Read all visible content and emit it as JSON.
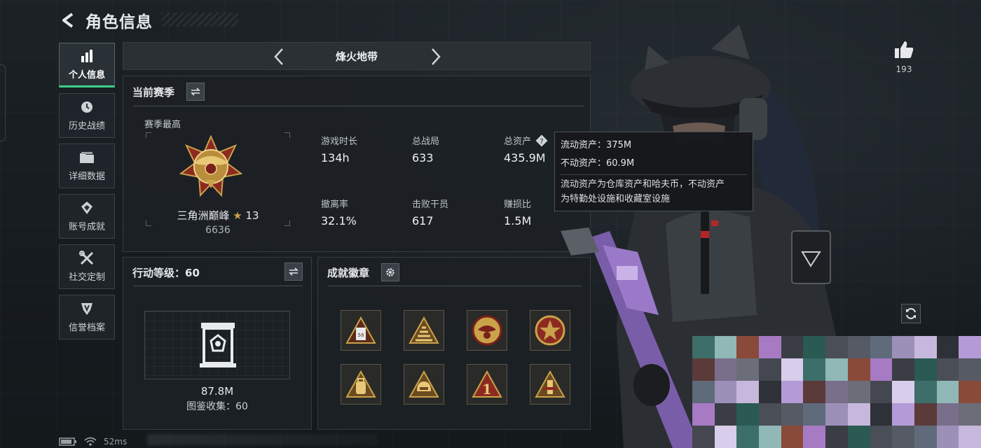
{
  "header": {
    "title": "角色信息"
  },
  "nav": {
    "items": [
      {
        "label": "个人信息",
        "icon": "bar-chart-icon",
        "active": true
      },
      {
        "label": "历史战绩",
        "icon": "clock-icon"
      },
      {
        "label": "详细数据",
        "icon": "folder-icon"
      },
      {
        "label": "账号成就",
        "icon": "achievement-icon"
      },
      {
        "label": "社交定制",
        "icon": "tools-icon"
      },
      {
        "label": "信誉档案",
        "icon": "shield-icon"
      }
    ]
  },
  "mode": {
    "name": "烽火地带"
  },
  "season": {
    "title": "当前赛季",
    "subtitle": "赛季最高",
    "rank_name": "三角洲巅峰",
    "rank_stars": "13",
    "rank_score": "6636",
    "stats": [
      {
        "label": "游戏时长",
        "value": "134h"
      },
      {
        "label": "总战局",
        "value": "633"
      },
      {
        "label": "总资产",
        "value": "435.9M",
        "has_help": true
      },
      {
        "label": "撤离率",
        "value": "32.1%"
      },
      {
        "label": "击败干员",
        "value": "617"
      },
      {
        "label": "赚损比",
        "value": "1.5M"
      }
    ]
  },
  "tooltip": {
    "line1": "流动资产：375M",
    "line2": "不动资产：60.9M",
    "desc_line1": "流动资产为仓库资产和哈夫币，不动资产",
    "desc_line2": "为特勤处设施和收藏室设施"
  },
  "level": {
    "title": "行动等级：60",
    "value": "87.8M",
    "collection": "图鉴收集：60"
  },
  "badges": {
    "title": "成就徽章",
    "items": [
      "ticket-badge-icon",
      "stairs-badge-icon",
      "eagle-medal-icon",
      "star-medal-icon",
      "backpack-badge-icon",
      "helmet-badge-icon",
      "number-one-badge-icon",
      "tower-badge-icon"
    ]
  },
  "likes": {
    "count": "193"
  },
  "status_bar": {
    "ping": "52ms"
  },
  "colors": {
    "accent": "#3fd08a",
    "gold": "#c9a24a",
    "panel_bg": "#1c2125"
  }
}
